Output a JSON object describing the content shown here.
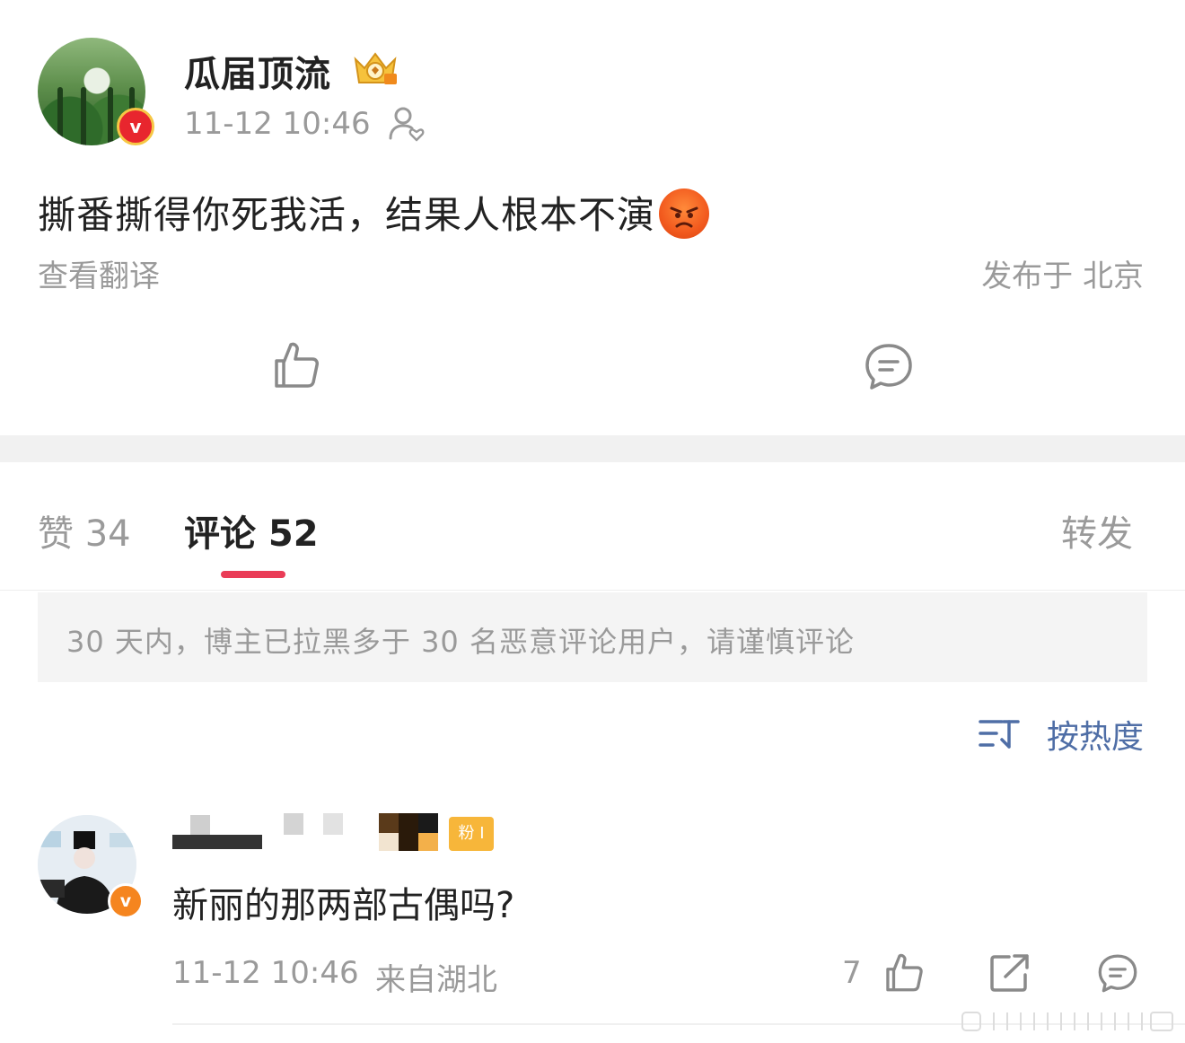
{
  "post": {
    "username": "瓜届顶流",
    "time": "11-12 10:46",
    "content": "撕番撕得你死我活，结果人根本不演",
    "translate_label": "查看翻译",
    "location": "发布于 北京"
  },
  "tabs": {
    "likes": "赞 34",
    "comments": "评论 52",
    "reposts": "转发"
  },
  "notice": "30 天内，博主已拉黑多于 30 名恶意评论用户，请谨慎评论",
  "sort_label": "按热度",
  "comment": {
    "badge": "粉 I",
    "text": "新丽的那两部古偶吗?",
    "time": "11-12 10:46",
    "from": "来自湖北",
    "like_count": "7"
  },
  "colors": {
    "accent_underline": "#ea3c57",
    "sort_blue": "#4f6ea6",
    "verified_red": "#e8262e",
    "verified_orange": "#f5851f"
  },
  "icons": [
    "crown-icon",
    "follow-person-icon",
    "angry-emoji-icon",
    "thumbs-up-icon",
    "comment-bubble-icon",
    "sort-icon",
    "share-icon"
  ]
}
